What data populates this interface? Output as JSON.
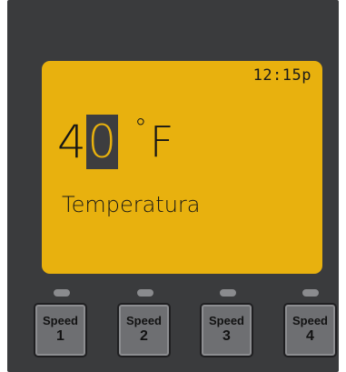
{
  "display": {
    "time": "12:15p",
    "temperature_digits": [
      "4",
      "0"
    ],
    "unit": "F",
    "degree_symbol": "°",
    "label": "Temperatura"
  },
  "buttons": [
    {
      "label": "Speed",
      "number": "1"
    },
    {
      "label": "Speed",
      "number": "2"
    },
    {
      "label": "Speed",
      "number": "3"
    },
    {
      "label": "Speed",
      "number": "4"
    }
  ],
  "colors": {
    "panel": "#3a3b3d",
    "lcd": "#e8b10e",
    "button": "#6e6f72",
    "indicator_off": "#8a8b8e"
  }
}
